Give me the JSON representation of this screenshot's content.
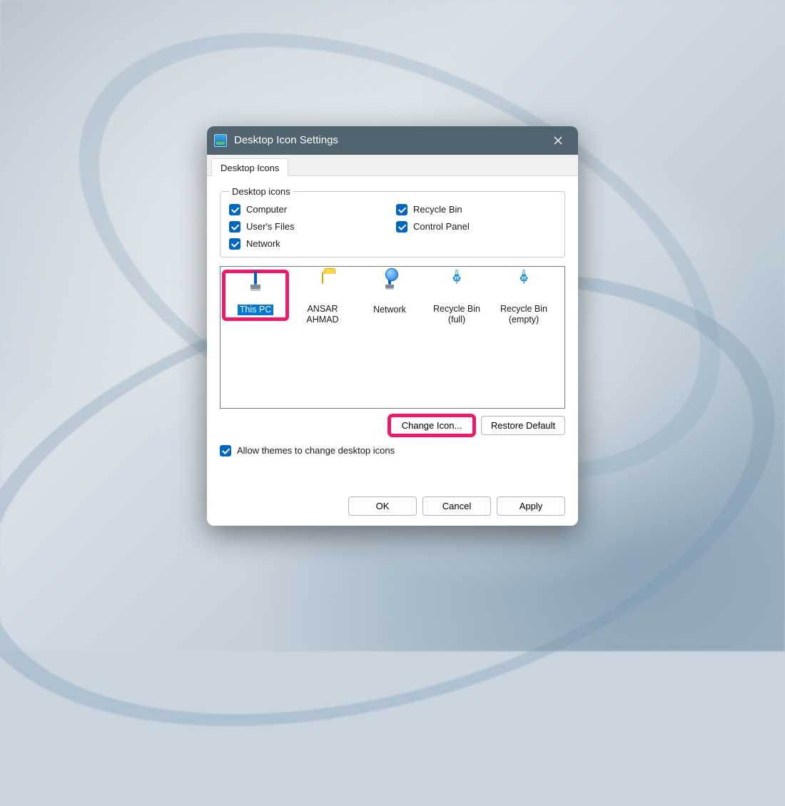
{
  "window": {
    "title": "Desktop Icon Settings"
  },
  "tab": {
    "label": "Desktop Icons"
  },
  "group": {
    "legend": "Desktop icons",
    "checks": {
      "computer": {
        "label": "Computer",
        "checked": true
      },
      "users_files": {
        "label": "User's Files",
        "checked": true
      },
      "network": {
        "label": "Network",
        "checked": true
      },
      "recycle_bin": {
        "label": "Recycle Bin",
        "checked": true
      },
      "control_panel": {
        "label": "Control Panel",
        "checked": true
      }
    }
  },
  "icons": {
    "this_pc": {
      "label": "This PC",
      "selected": true,
      "highlighted": true
    },
    "user": {
      "label": "ANSAR AHMAD",
      "selected": false
    },
    "network": {
      "label": "Network",
      "selected": false
    },
    "bin_full": {
      "label": "Recycle Bin (full)",
      "selected": false
    },
    "bin_empty": {
      "label": "Recycle Bin (empty)",
      "selected": false
    }
  },
  "buttons": {
    "change_icon": "Change Icon...",
    "restore_default": "Restore Default",
    "ok": "OK",
    "cancel": "Cancel",
    "apply": "Apply"
  },
  "allow_themes": {
    "label": "Allow themes to change desktop icons",
    "checked": true
  }
}
